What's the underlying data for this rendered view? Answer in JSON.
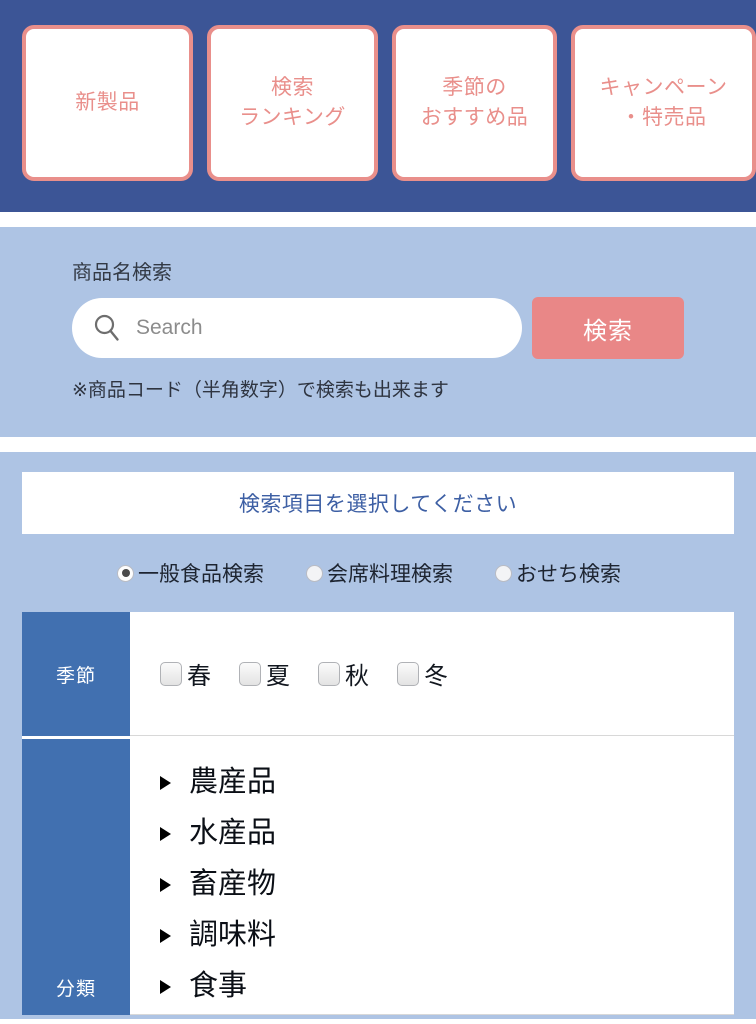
{
  "colors": {
    "nav_band": "#3c5596",
    "card_border": "#e98f8b",
    "card_text": "#e98f8b",
    "panel_blue": "#aec4e4",
    "button_salmon": "#e98787",
    "table_header_blue": "#4170b0",
    "banner_text_blue": "#3d5fa4"
  },
  "topnav": {
    "cards": [
      {
        "name": "new-products",
        "lines": [
          "新製品"
        ]
      },
      {
        "name": "search-ranking",
        "lines": [
          "検索",
          "ランキング"
        ]
      },
      {
        "name": "seasonal-recommendations",
        "lines": [
          "季節の",
          "おすすめ品"
        ]
      },
      {
        "name": "campaign-specials",
        "lines": [
          "キャンペーン",
          "・特売品"
        ]
      }
    ]
  },
  "search": {
    "label": "商品名検索",
    "placeholder": "Search",
    "value": "",
    "button_label": "検索",
    "icon": "search-icon",
    "note": "※商品コード（半角数字）で検索も出来ます"
  },
  "select_section": {
    "banner": "検索項目を選択してください",
    "radios": [
      {
        "label": "一般食品検索",
        "checked": true
      },
      {
        "label": "会席料理検索",
        "checked": false
      },
      {
        "label": "おせち検索",
        "checked": false
      }
    ]
  },
  "filter_table": {
    "rows": [
      {
        "header": "季節",
        "type": "checkboxes",
        "items": [
          {
            "label": "春",
            "checked": false
          },
          {
            "label": "夏",
            "checked": false
          },
          {
            "label": "秋",
            "checked": false
          },
          {
            "label": "冬",
            "checked": false
          }
        ]
      },
      {
        "header": "分類",
        "type": "tree",
        "items": [
          {
            "label": "農産品",
            "expanded": false
          },
          {
            "label": "水産品",
            "expanded": false
          },
          {
            "label": "畜産物",
            "expanded": false
          },
          {
            "label": "調味料",
            "expanded": false
          },
          {
            "label": "食事",
            "expanded": false
          }
        ]
      }
    ]
  }
}
